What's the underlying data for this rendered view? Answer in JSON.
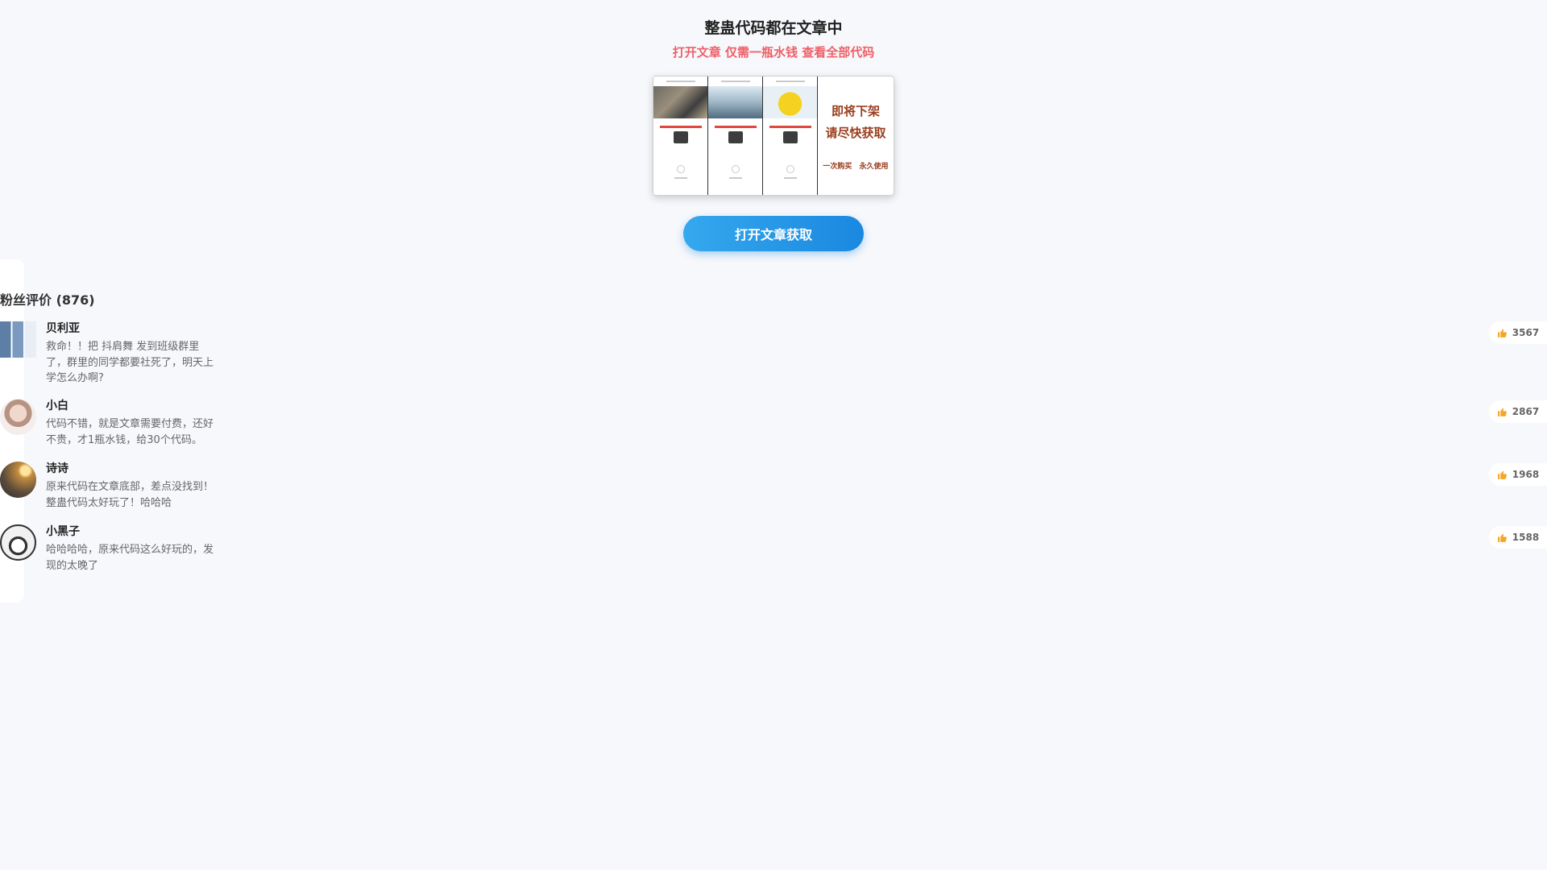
{
  "header": {
    "title": "整蛊代码都在文章中",
    "subtitle": "打开文章 仅需一瓶水钱 查看全部代码"
  },
  "preview": {
    "promo_line1": "即将下架",
    "promo_line2": "请尽快获取",
    "promo_small": "一次购买 永久使用"
  },
  "cta": {
    "label": "打开文章获取"
  },
  "reviews": {
    "title": "粉丝评价 (876)",
    "items": [
      {
        "name": "贝利亚",
        "text": "救命！！把 抖肩舞 发到班级群里了，群里的同学都要社死了，明天上学怎么办啊?",
        "likes": "3567"
      },
      {
        "name": "小白",
        "text": "代码不错，就是文章需要付费，还好不贵，才1瓶水钱，给30个代码。",
        "likes": "2867"
      },
      {
        "name": "诗诗",
        "text": "原来代码在文章底部，差点没找到！整蛊代码太好玩了！哈哈哈",
        "likes": "1968"
      },
      {
        "name": "小黑子",
        "text": "哈哈哈哈，原来代码这么好玩的，发现的太晚了",
        "likes": "1588"
      }
    ]
  },
  "colors": {
    "accent_red": "#ef5f68",
    "button_blue": "#1a88e0",
    "promo_brown": "#9a3f20",
    "thumb": "#f5a623"
  },
  "icons": {
    "like": "thumbs-up-icon"
  }
}
